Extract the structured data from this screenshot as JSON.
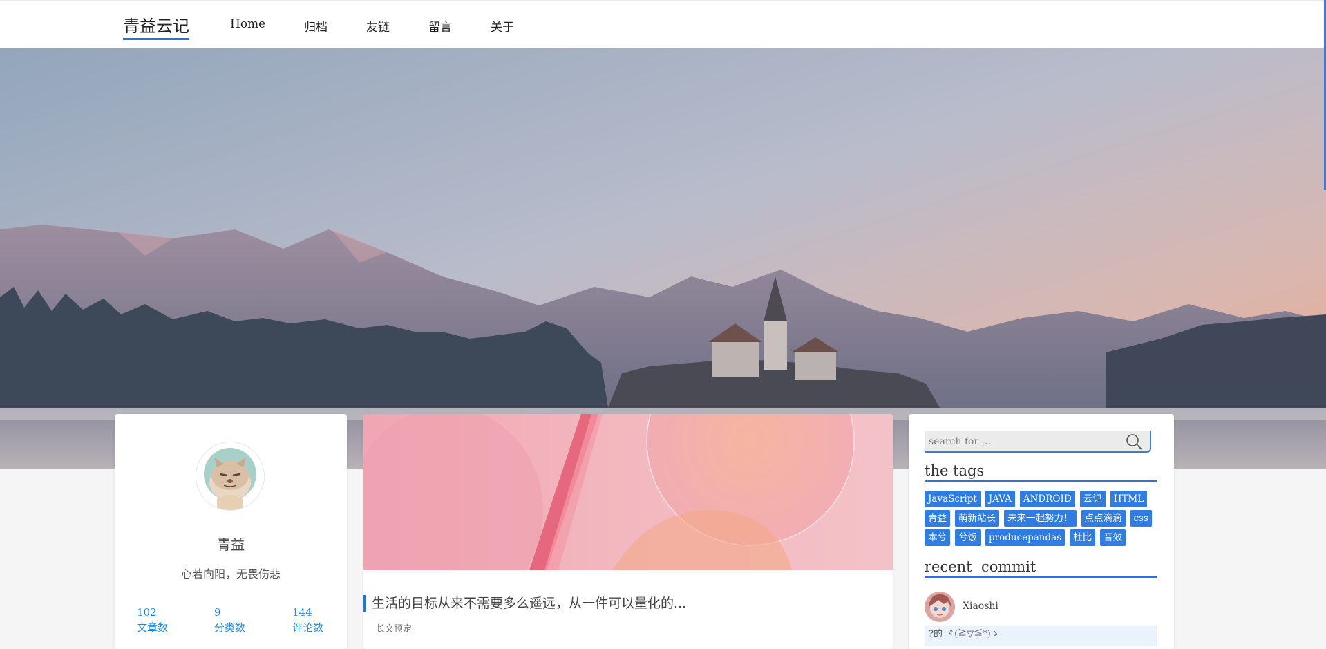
{
  "nav": {
    "brand": "青益云记",
    "items": [
      "Home",
      "归档",
      "友链",
      "留言",
      "关于"
    ]
  },
  "profile": {
    "name": "青益",
    "motto": "心若向阳，无畏伤悲",
    "stats": [
      {
        "count": "102",
        "label": "文章数"
      },
      {
        "count": "9",
        "label": "分类数"
      },
      {
        "count": "144",
        "label": "评论数"
      }
    ]
  },
  "post": {
    "title": "生活的目标从来不需要多么遥远，从一件可以量化的...",
    "excerpt": "长文预定"
  },
  "sidebar": {
    "search_placeholder": "search for ...",
    "tags_title": "the tags",
    "tag_rows": [
      [
        "JavaScript",
        "JAVA",
        "ANDROID",
        "云记",
        "HTML"
      ],
      [
        "青益",
        "萌新站长",
        "未来一起努力！",
        "点点滴滴",
        "css"
      ],
      [
        "本兮",
        "兮饭",
        "producepandas",
        "杜比",
        "音效"
      ]
    ],
    "recent_title": "recent  commit",
    "recent_commenter": "Xiaoshi",
    "recent_comment": "?的 ヾ(≧▽≦*)ゝ"
  },
  "colors": {
    "accent": "#1e73e8",
    "link": "#1e88e5",
    "tag_bg": "#2f7ce3",
    "comment_bg": "#eaf3fc"
  }
}
